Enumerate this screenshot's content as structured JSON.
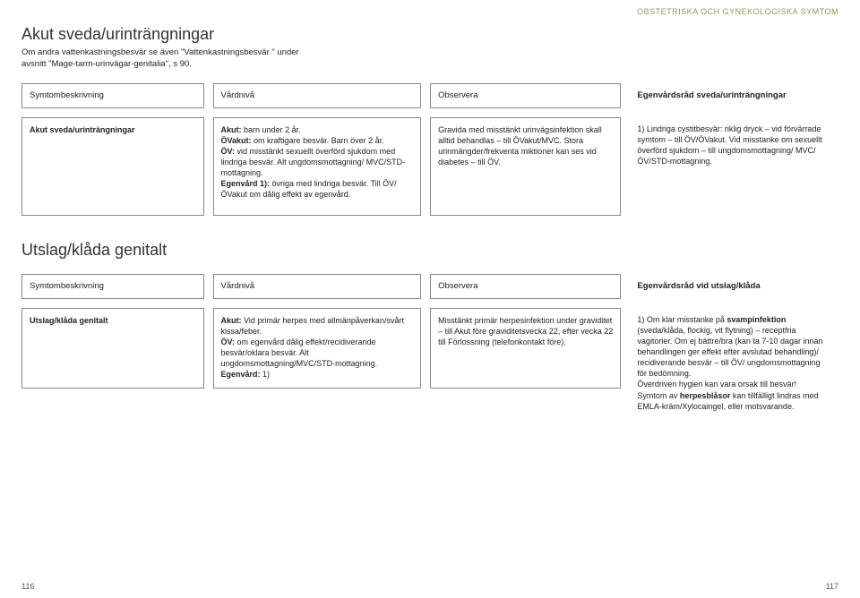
{
  "topBanner": "OBSTETRISKA OCH GYNEKOLOGISKA SYMTOM",
  "section1": {
    "title": "Akut sveda/urinträngningar",
    "intro": "Om andra vattenkastningsbesvär se även \"Vattenkastningsbesvär \" under avsnitt \"Mage-tarm-urinvägar-genitalia\", s 90.",
    "headers": {
      "c1": "Symtombeskrivning",
      "c2": "Vårdnivå",
      "c3": "Observera",
      "c4": "Egenvårdsråd sveda/urinträngningar"
    },
    "row": {
      "c1_bold": "Akut sveda/urinträngningar",
      "c2_l1b": "Akut:",
      "c2_l1": " barn under 2 år.",
      "c2_l2b": "ÖVakut:",
      "c2_l2": " om kraftigare besvär. Barn över 2 år.",
      "c2_l3b": "ÖV:",
      "c2_l3": " vid misstänkt sexuellt överförd sjukdom med lindriga besvär. Alt ungdomsmottagning/ MVC/STD-mottagning.",
      "c2_l4b": "Egenvård 1):",
      "c2_l4": " övriga med lindriga besvär. Till ÖV/ÖVakut om dålig effekt av egenvård.",
      "c3": "Gravida med misstänkt urinvägsinfektion skall alltid behandlas – till ÖVakut/MVC. Stora urinmängder/frekventa miktioner kan ses vid diabetes – till ÖV.",
      "c4": "1) Lindriga cystitbesvär: riklig dryck – vid förvärrade symtom – till ÖV/ÖVakut. Vid misstanke om sexuellt överförd sjukdom – till ungdomsmottagning/ MVC/ÖV/STD-mottagning."
    }
  },
  "section2": {
    "title": "Utslag/klåda genitalt",
    "headers": {
      "c1": "Symtombeskrivning",
      "c2": "Vårdnivå",
      "c3": "Observera",
      "c4": "Egenvårdsråd vid utslag/klåda"
    },
    "row": {
      "c1_bold": "Utslag/klåda genitalt",
      "c2_l1b": "Akut:",
      "c2_l1": " Vid primär herpes med allmänpåverkan/svårt kissa/feber.",
      "c2_l2b": "ÖV:",
      "c2_l2": " om egenvård dålig effekt/recidiverande besvär/oklara besvär. Alt ungdomsmottagning/MVC/STD-mottagning.",
      "c2_l3b": "Egenvård:",
      "c2_l3": " 1)",
      "c3": "Misstänkt primär herpesinfektion under graviditet – till Akut före graviditetsvecka 22, efter vecka 22 till Förlossning (telefonkontakt före).",
      "c4_p1a": "1) Om klar misstanke på ",
      "c4_p1b": "svampinfektion",
      "c4_p1c": " (sveda/klåda, flockig, vit flytning) – receptfria vagitorier. Om ej bättre/bra (kan ta 7-10 dagar innan behandlingen ger effekt efter avslutad behandling)/ recidiverande besvär – till ÖV/ ungdomsmottagning för bedömning.",
      "c4_p2": "Överdriven hygien kan vara orsak till besvär!",
      "c4_p3a": "Symtom av ",
      "c4_p3b": "herpesblåsor",
      "c4_p3c": " kan tillfälligt lindras med EMLA-kräm/Xylocaingel, eller motsvarande."
    }
  },
  "pageLeft": "116",
  "pageRight": "117"
}
